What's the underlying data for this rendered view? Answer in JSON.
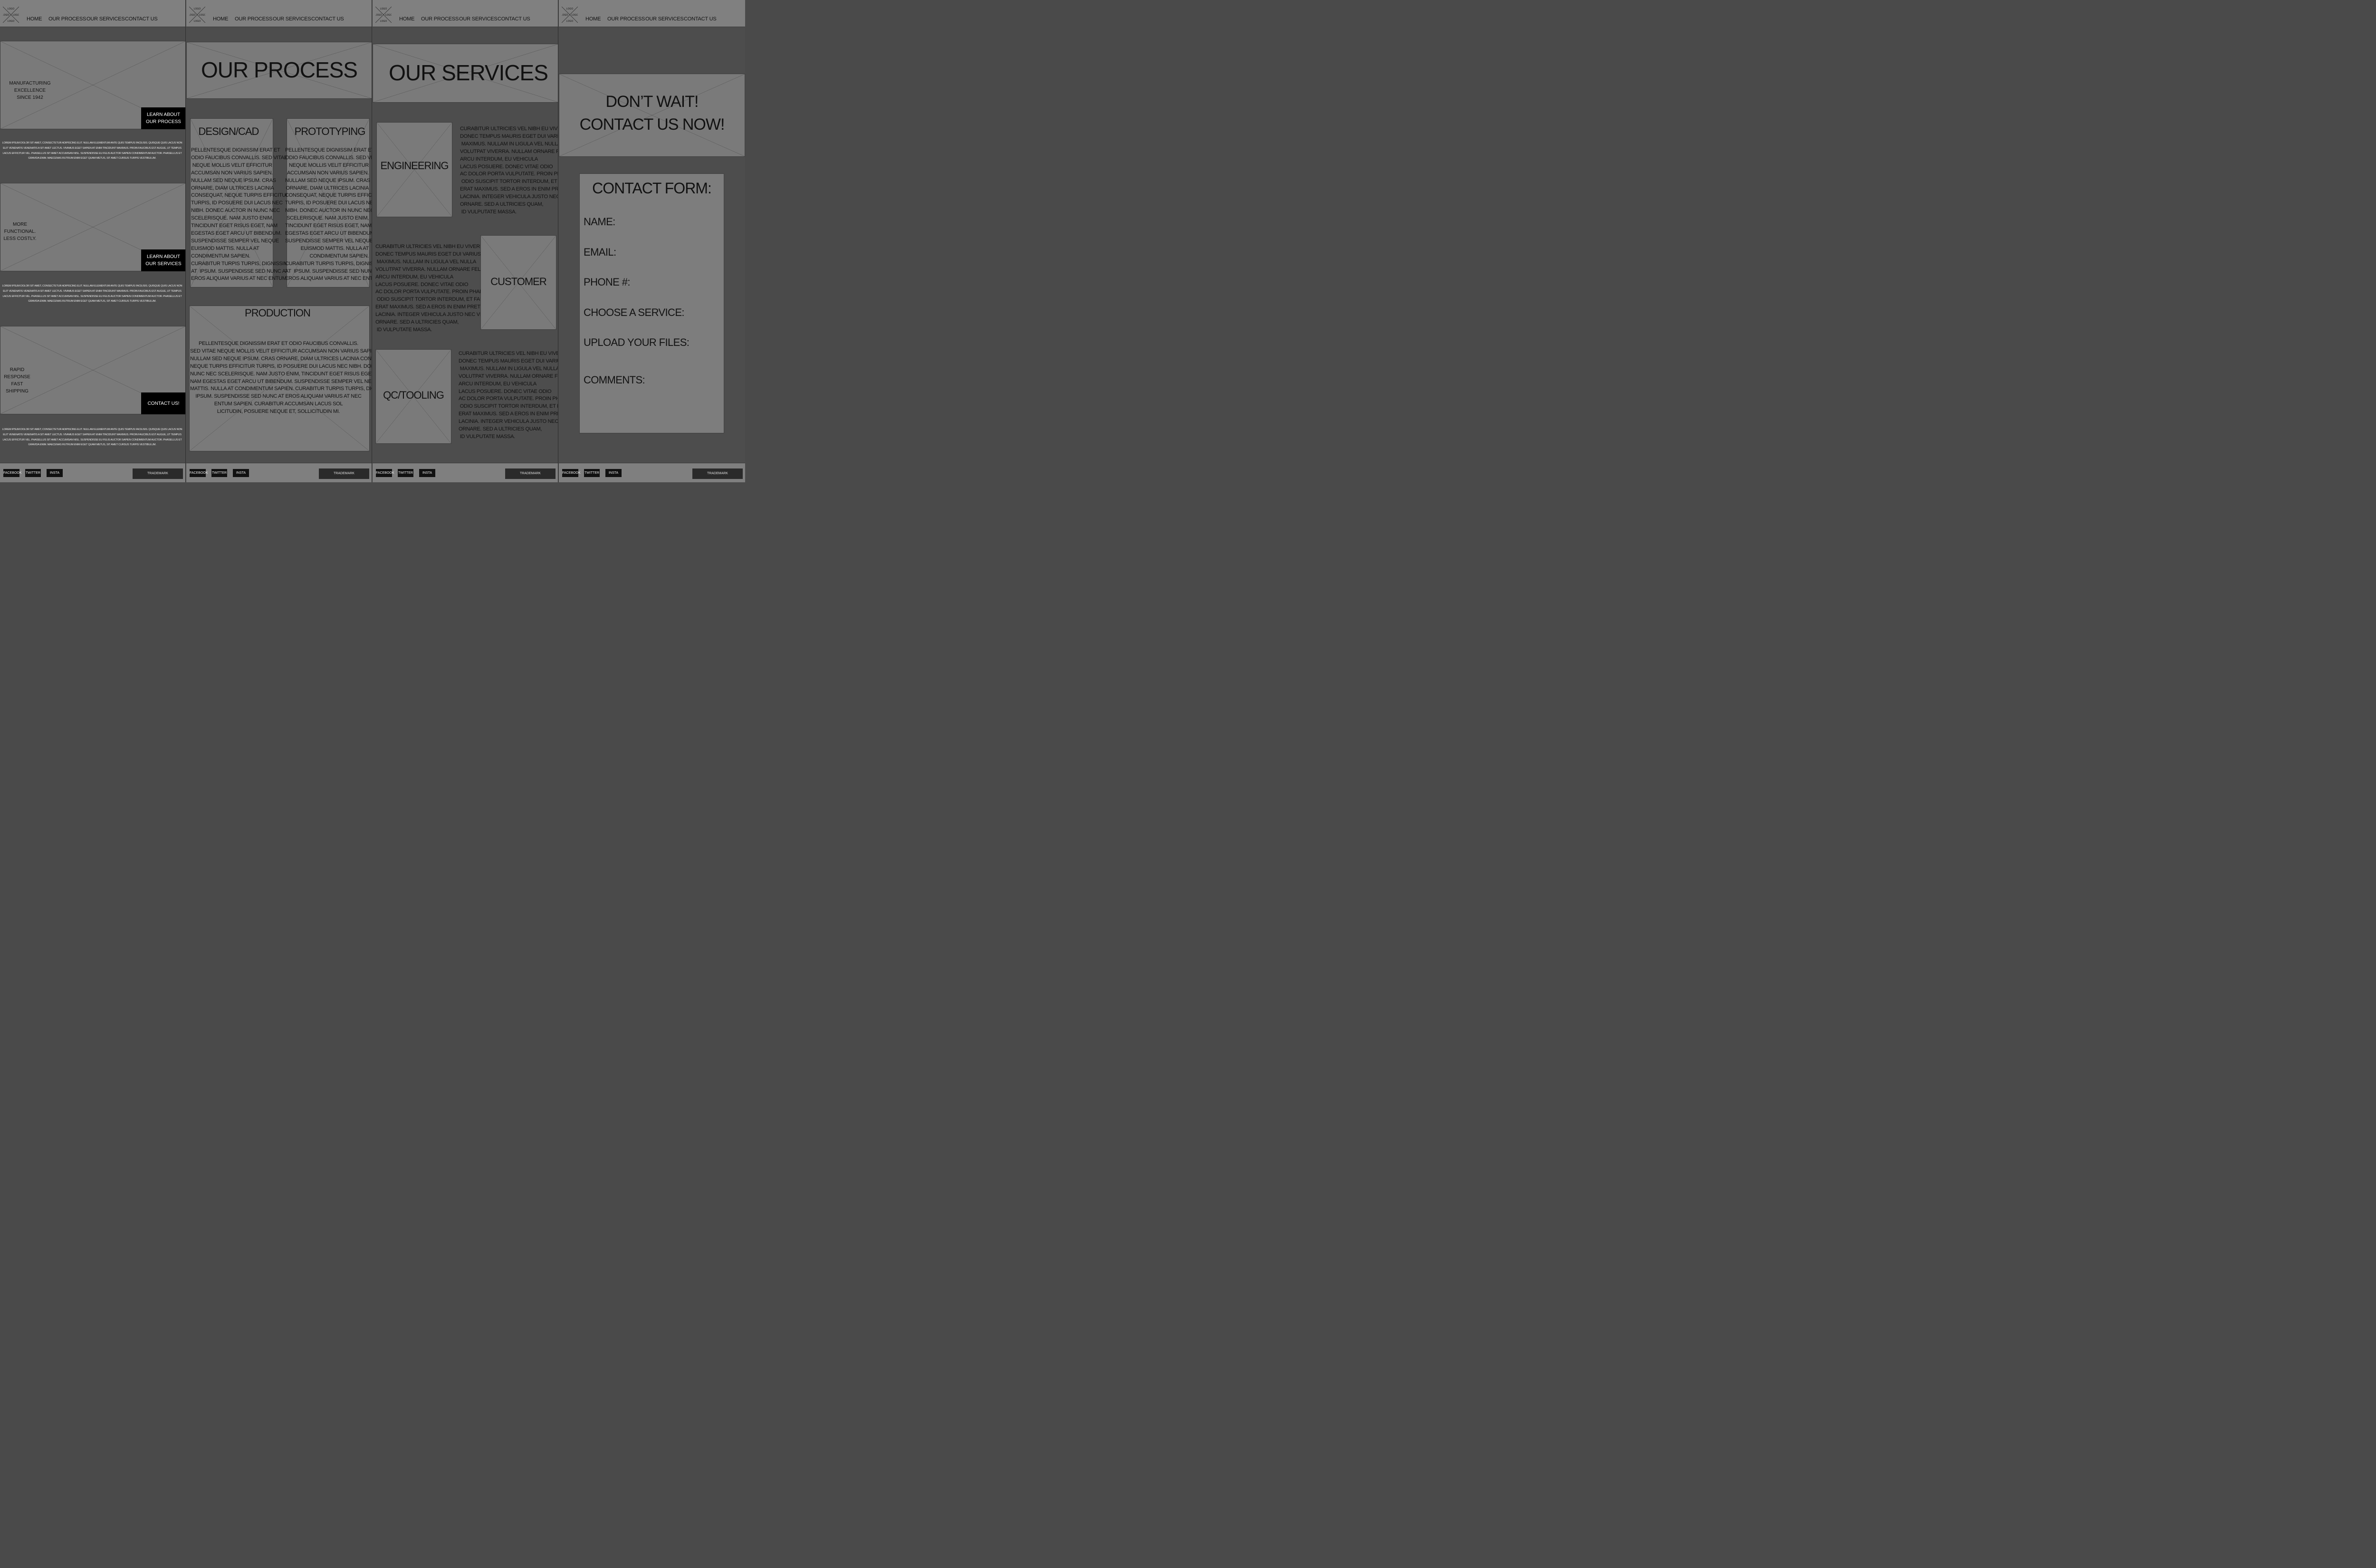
{
  "nav": {
    "logo_text": "LOGO",
    "home": "HOME",
    "process": "OUR PROCESS",
    "services": "OUR SERVICES",
    "contact": "CONTACT US"
  },
  "footer": {
    "facebook": "FACEBOOK",
    "twitter": "TWITTER",
    "insta": "INSTA",
    "trademark": "TRADEMARK"
  },
  "home": {
    "hero1_text": "MANUFACTURING EXCELLENCE\nSINCE 1942",
    "hero1_cta": "LEARN ABOUT\nOUR PROCESS",
    "hero2_text": "MORE FUNCTIONAL.\nLESS COSTLY.",
    "hero2_cta": "LEARN ABOUT\nOUR SERVICES",
    "hero3_text": "RAPID RESPONSE\nFAST SHIPPING",
    "hero3_cta": "CONTACT US!",
    "lorem": "LOREM IPSUM DOLOR SIT AMET, CONSECTETUR ADIPISCING ELIT. NULLAM ELEMENTUM ANTE QUIS TEMPUS FACILISIS. QUISQUE QUIS LACUS NON ELIT VENENATIS VENENATIS A SIT AMET LECTUS. VIVAMUS EGET SAPIEN AT ENIM TINCIDUNT MAXIMUS. PROIN FAUCIBUS EST AUGUE, UT TEMPUS LACUS EFFICITUR VEL. PHASELLUS SIT AMET ACCUMSAN NISL. SUSPENDISSE EU FELIS AUCTOR SAPIEN CONDIMENTUM AUCTOR. PHASELLUS ET GRAVIDA ENIM. MAECENAS RUTRUM ENIM EGET QUAM METUS, SIT AMET CURSUS TURPIS VESTIBULUM."
  },
  "process": {
    "title": "OUR PROCESS",
    "design_title": "DESIGN/CAD",
    "design_text": "PELLENTESQUE DIGNISSIM ERAT ET\nODIO FAUCIBUS CONVALLIS. SED VITAE\n NEQUE MOLLIS VELIT EFFICITUR\nACCUMSAN NON VARIUS SAPIEN.\nNULLAM SED NEQUE IPSUM. CRAS\nORNARE, DIAM ULTRICES LACINIA\nCONSEQUAT, NEQUE TURPIS EFFICITUR\nTURPIS, ID POSUERE DUI LACUS NEC\nNIBH. DONEC AUCTOR IN NUNC NEC\nSCELERISQUE. NAM JUSTO ENIM,\nTINCIDUNT EGET RISUS EGET, NAM\nEGESTAS EGET ARCU UT BIBENDUM.\nSUSPENDISSE SEMPER VEL NEQUE\nEUISMOD MATTIS. NULLA AT\nCONDIMENTUM SAPIEN.\nCURABITUR TURPIS TURPIS, DIGNISSIM\nAT  IPSUM. SUSPENDISSE SED NUNC AT\nEROS ALIQUAM VARIUS AT NEC ENTUM",
    "proto_title": "PROTOTYPING",
    "proto_text": "PELLENTESQUE DIGNISSIM ERAT ET\nODIO FAUCIBUS CONVALLIS. SED VITAE\nNEQUE MOLLIS VELIT EFFICITUR\nACCUMSAN NON VARIUS SAPIEN.\nNULLAM SED NEQUE IPSUM. CRAS\nORNARE, DIAM ULTRICES LACINIA\nCONSEQUAT, NEQUE TURPIS EFFICITUR\nTURPIS, ID POSUERE DUI LACUS NEC\nNIBH. DONEC AUCTOR IN NUNC NEC\nSCELERISQUE. NAM JUSTO ENIM,\nTINCIDUNT EGET RISUS EGET, NAM\nEGESTAS EGET ARCU UT BIBENDUM.\nSUSPENDISSE SEMPER VEL NEQUE\nEUISMOD MATTIS. NULLA AT\nCONDIMENTUM SAPIEN.\nCURABITUR TURPIS TURPIS, DIGNISSIM\nAT  IPSUM. SUSPENDISSE SED NUNC AT\nEROS ALIQUAM VARIUS AT NEC ENTUM",
    "production_title": "PRODUCTION",
    "production_text": "PELLENTESQUE DIGNISSIM ERAT ET ODIO FAUCIBUS CONVALLIS.\nSED VITAE NEQUE MOLLIS VELIT EFFICITUR ACCUMSAN NON VARIUS SAPIEN.\nNULLAM SED NEQUE IPSUM. CRAS ORNARE, DIAM ULTRICES LACINIA CONSEQUAT,\nNEQUE TURPIS EFFICITUR TURPIS, ID POSUERE DUI LACUS NEC NIBH. DONEC AUCTOR IN\nNUNC NEC SCELERISQUE. NAM JUSTO ENIM, TINCIDUNT EGET RISUS EGET,\nNAM EGESTAS EGET ARCU UT BIBENDUM. SUSPENDISSE SEMPER VEL NEQUE EUISMOD\nMATTIS. NULLA AT CONDIMENTUM SAPIEN. CURABITUR TURPIS TURPIS, DIGNISSIM AT\nIPSUM. SUSPENDISSE SED NUNC AT EROS ALIQUAM VARIUS AT NEC\nENTUM SAPIEN. CURABITUR ACCUMSAN LACUS SOL\nLICITUDIN, POSUERE NEQUE ET, SOLLICITUDIN MI."
  },
  "services": {
    "title": "OUR SERVICES",
    "engineering_title": "ENGINEERING",
    "customer_title": "CUSTOMER",
    "qc_title": "QC/TOOLING",
    "service_text": "CURABITUR ULTRICIES VEL NIBH EU VIVERRA.\nDONEC TEMPUS MAURIS EGET DUI VARIUS\n MAXIMUS. NULLAM IN LIGULA VEL NULLA\nVOLUTPAT VIVERRA. NULLAM ORNARE FELIS UT\nARCU INTERDUM, EU VEHICULA\nLACUS POSUERE. DONEC VITAE ODIO\nAC DOLOR PORTA VULPUTATE. PROIN PHARETRA\n ODIO SUSCIPIT TORTOR INTERDUM, ET FAUCIBUS\nERAT MAXIMUS. SED A EROS IN ENIM PRETIUM\nLACINIA. INTEGER VEHICULA JUSTO NEC VIVERRA\nORNARE. SED A ULTRICIES QUAM,\n ID VULPUTATE MASSA."
  },
  "contact": {
    "headline": "DON’T WAIT!\nCONTACT US NOW!",
    "form_title": "CONTACT FORM:",
    "name_label": "NAME:",
    "email_label": "EMAIL:",
    "phone_label": "PHONE #:",
    "service_label": "CHOOSE A SERVICE:",
    "upload_label": "UPLOAD YOUR FILES:",
    "comments_label": "COMMENTS:"
  }
}
